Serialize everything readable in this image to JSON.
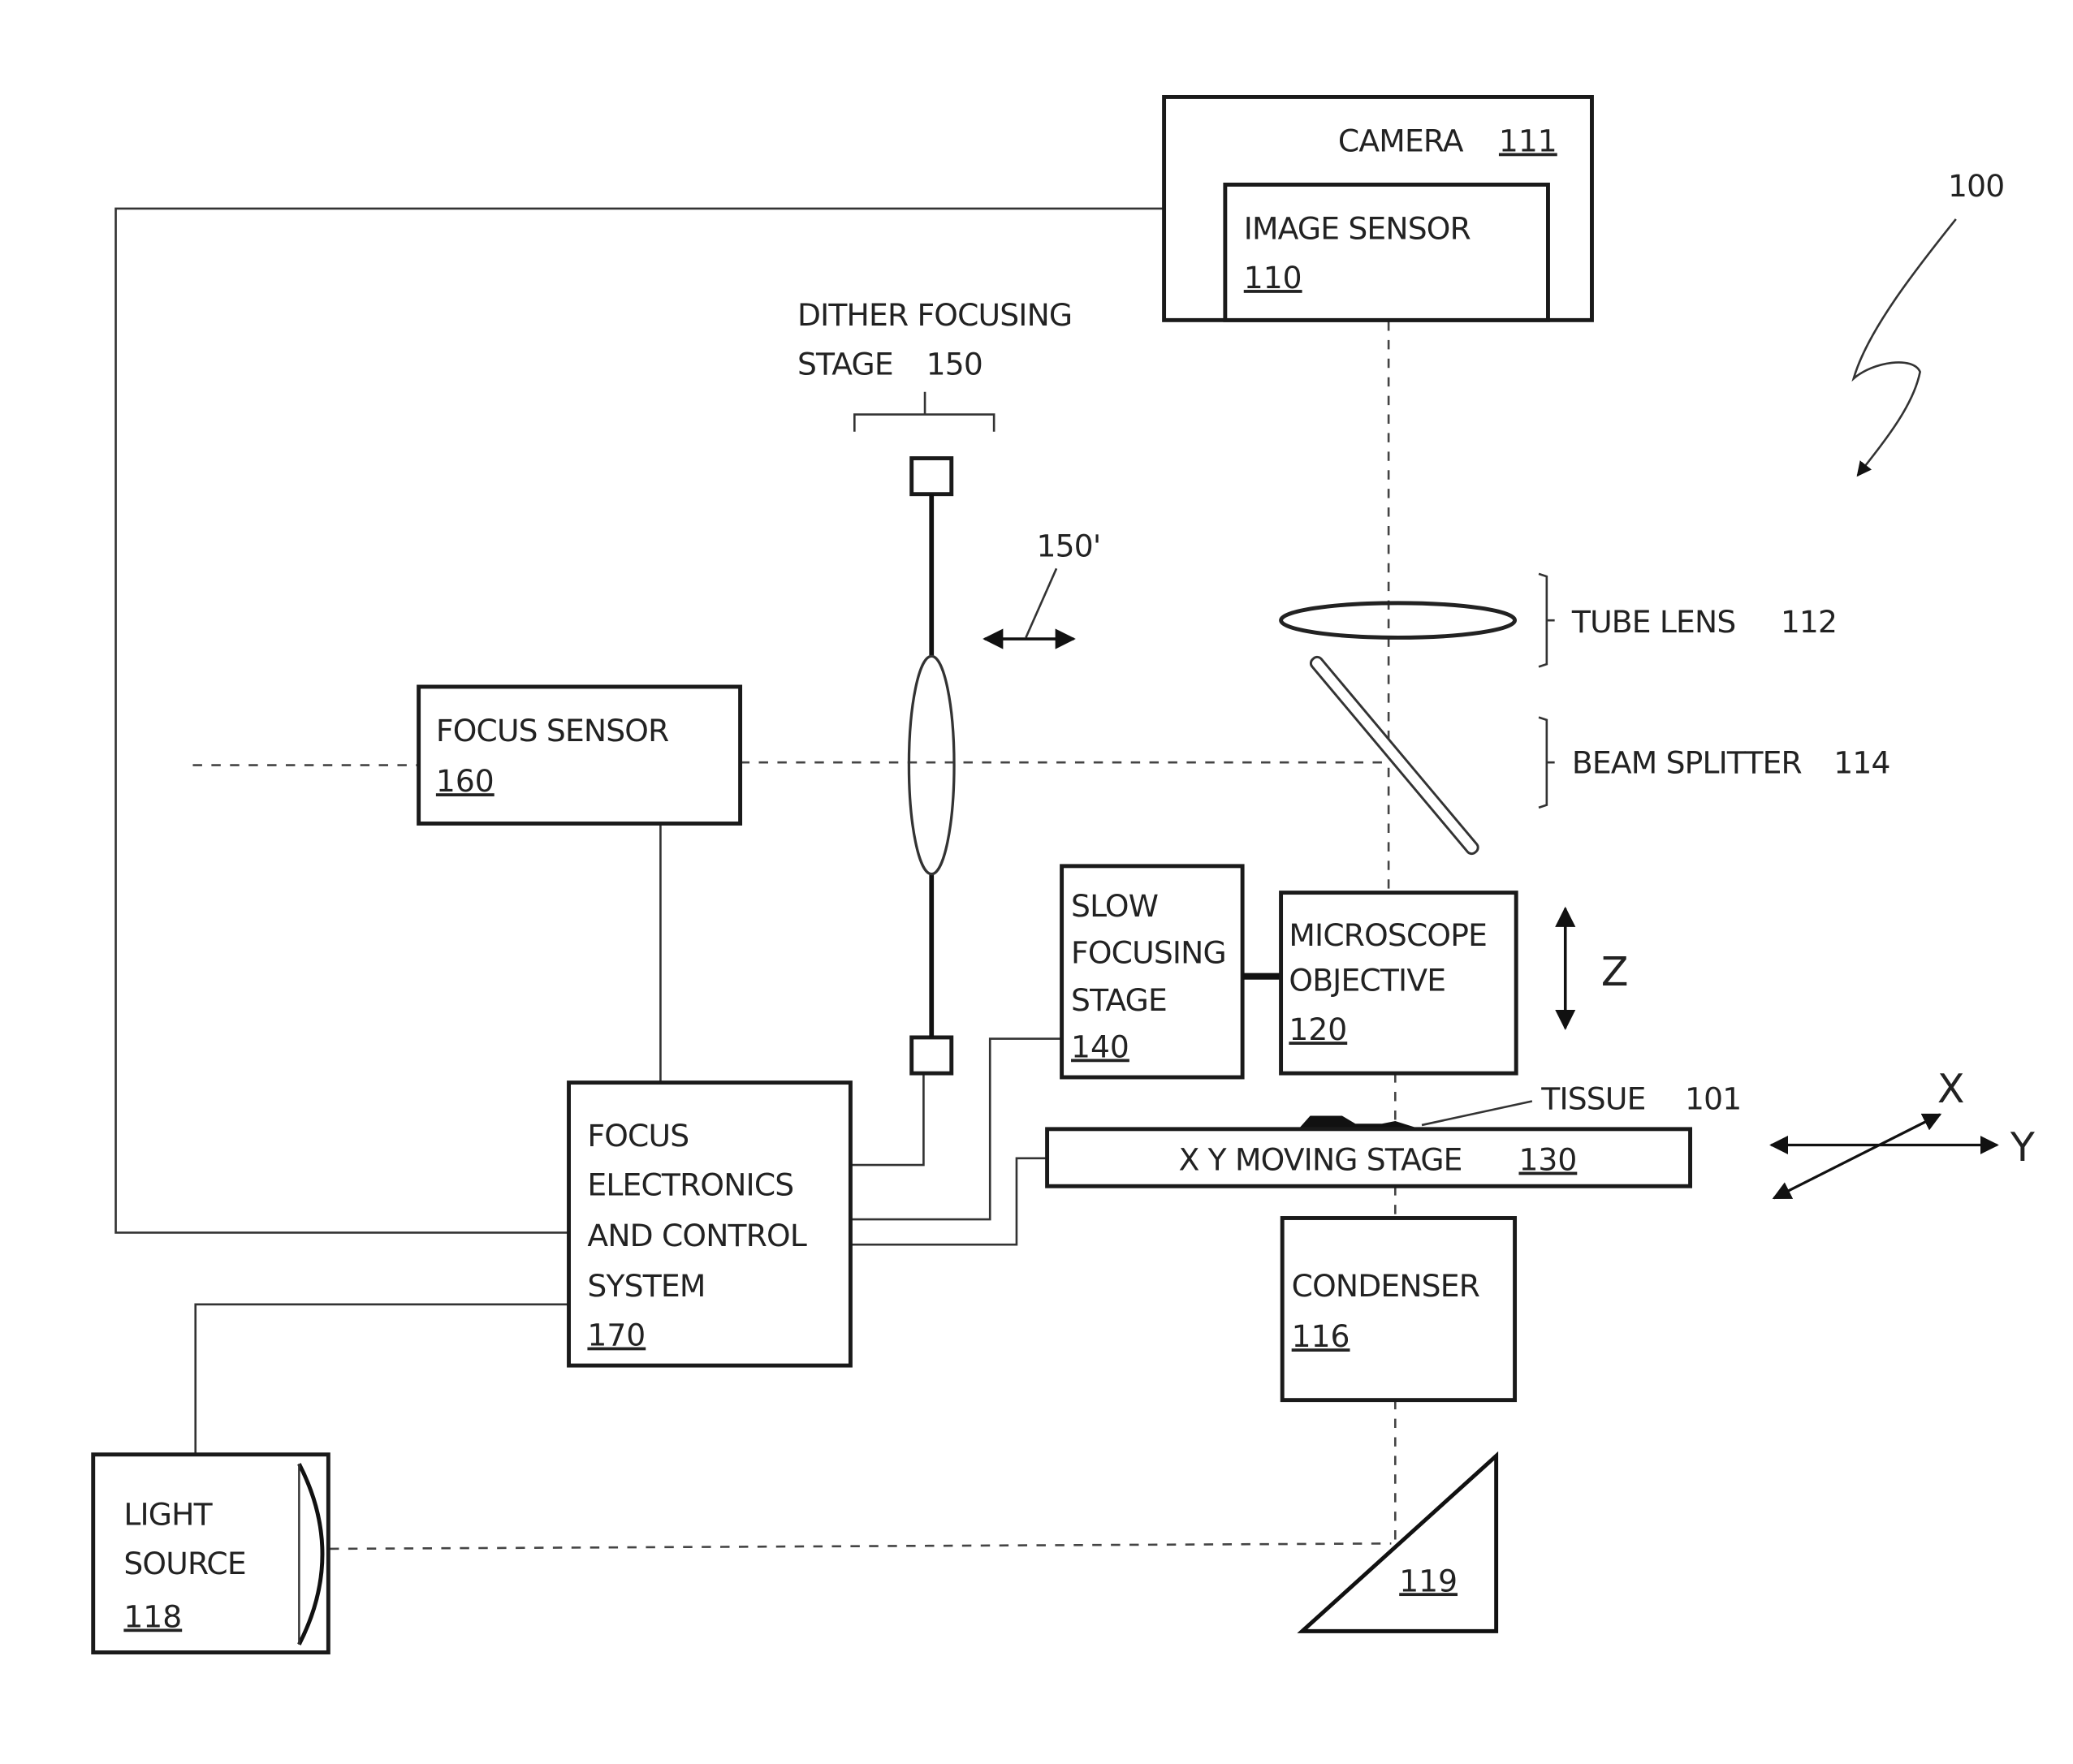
{
  "figure": {
    "reference": "100",
    "components": {
      "camera": {
        "label": "CAMERA",
        "ref": "111"
      },
      "image_sensor": {
        "label": "IMAGE SENSOR",
        "ref": "110"
      },
      "dither_stage": {
        "label_line1": "DITHER FOCUSING",
        "label_line2": "STAGE",
        "ref": "150",
        "motion_ref": "150'"
      },
      "tube_lens": {
        "label": "TUBE LENS",
        "ref": "112"
      },
      "beam_splitter": {
        "label": "BEAM SPLITTER",
        "ref": "114"
      },
      "focus_sensor": {
        "label": "FOCUS SENSOR",
        "ref": "160"
      },
      "slow_stage": {
        "line1": "SLOW",
        "line2": "FOCUSING",
        "line3": "STAGE",
        "ref": "140"
      },
      "objective": {
        "line1": "MICROSCOPE",
        "line2": "OBJECTIVE",
        "ref": "120"
      },
      "tissue": {
        "label": "TISSUE",
        "ref": "101"
      },
      "xy_stage": {
        "label": "X Y MOVING STAGE",
        "ref": "130"
      },
      "control": {
        "line1": "FOCUS",
        "line2": "ELECTRONICS",
        "line3": "AND CONTROL",
        "line4": "SYSTEM",
        "ref": "170"
      },
      "condenser": {
        "label": "CONDENSER",
        "ref": "116"
      },
      "light_source": {
        "line1": "LIGHT",
        "line2": "SOURCE",
        "ref": "118"
      },
      "mirror": {
        "ref": "119"
      }
    },
    "axes": {
      "z": "Z",
      "x": "X",
      "y": "Y"
    }
  }
}
